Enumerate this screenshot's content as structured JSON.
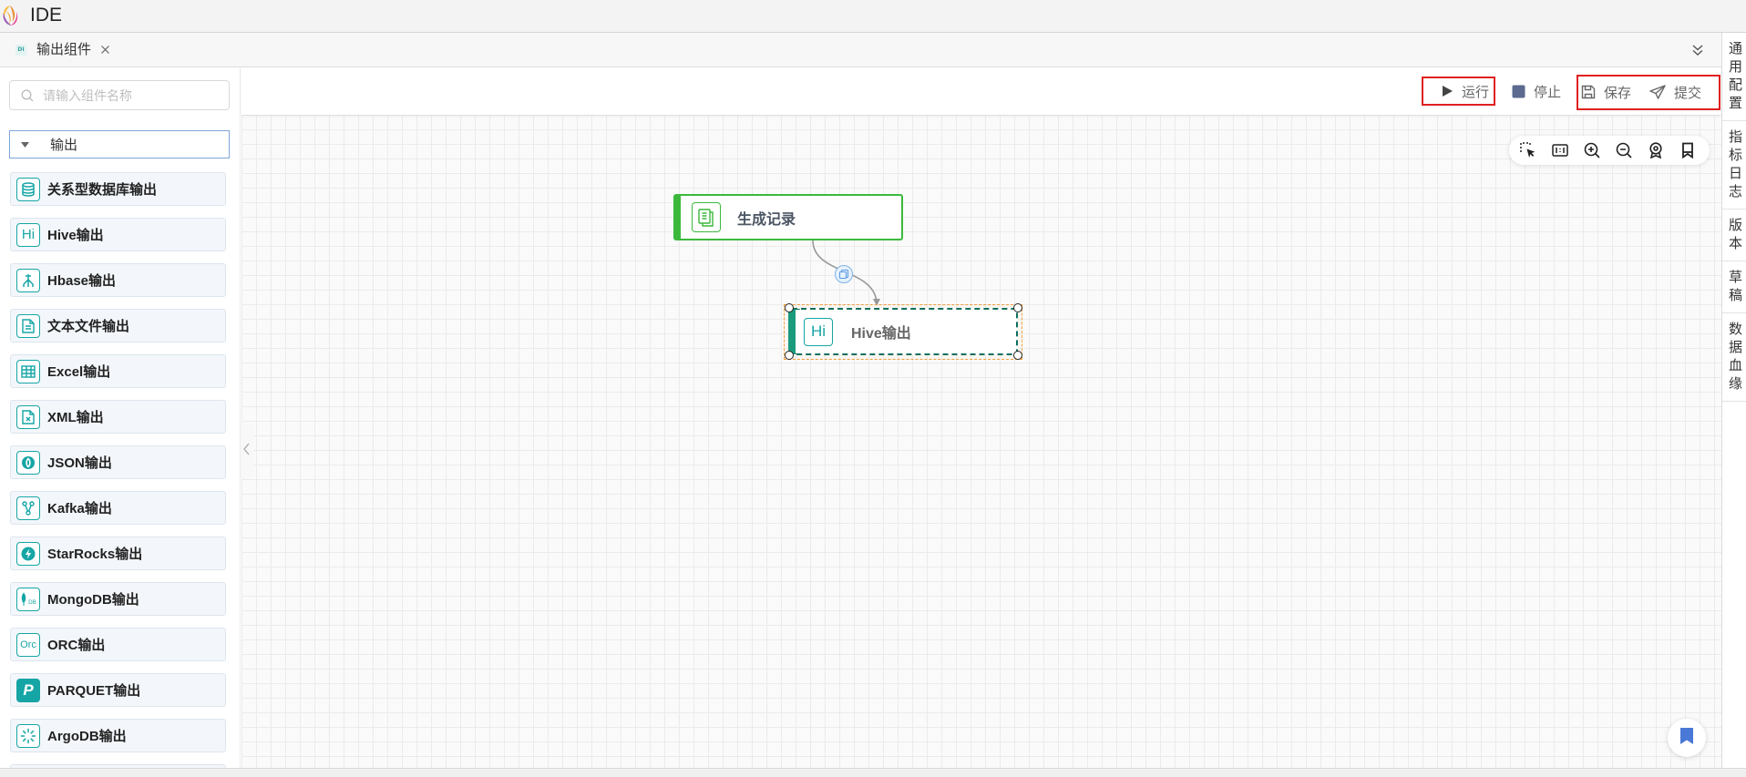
{
  "app": {
    "title": "IDE"
  },
  "tab": {
    "icon_text": "DI",
    "label": "输出组件"
  },
  "toolbar": {
    "run": "运行",
    "stop": "停止",
    "save": "保存",
    "submit": "提交"
  },
  "search": {
    "placeholder": "请输入组件名称",
    "value": ""
  },
  "category": {
    "label": "输出"
  },
  "components": [
    {
      "label": "关系型数据库输出",
      "icon": "database-icon"
    },
    {
      "label": "Hive输出",
      "icon": "hive-icon",
      "icon_text": "Hi"
    },
    {
      "label": "Hbase输出",
      "icon": "hbase-icon"
    },
    {
      "label": "文本文件输出",
      "icon": "text-file-icon"
    },
    {
      "label": "Excel输出",
      "icon": "excel-table-icon"
    },
    {
      "label": "XML输出",
      "icon": "xml-file-icon"
    },
    {
      "label": "JSON输出",
      "icon": "json-icon"
    },
    {
      "label": "Kafka输出",
      "icon": "kafka-icon"
    },
    {
      "label": "StarRocks输出",
      "icon": "starrocks-icon"
    },
    {
      "label": "MongoDB输出",
      "icon": "mongodb-icon",
      "icon_text": "DB"
    },
    {
      "label": "ORC输出",
      "icon": "orc-icon",
      "icon_text": "Orc"
    },
    {
      "label": "PARQUET输出",
      "icon": "parquet-icon",
      "icon_text": "P"
    },
    {
      "label": "ArgoDB输出",
      "icon": "argodb-icon"
    }
  ],
  "right_sidebar": {
    "items": [
      "通用配置",
      "指标日志",
      "版本",
      "草稿",
      "数据血缘"
    ]
  },
  "canvas": {
    "nodes": [
      {
        "label": "生成记录",
        "icon": "document-icon",
        "color": "#3cb93c",
        "selected": false
      },
      {
        "label": "Hive输出",
        "icon": "hive-icon",
        "icon_text": "Hi",
        "color": "#1a9b7c",
        "selected": true
      }
    ],
    "edges": [
      {
        "from": 0,
        "to": 1
      }
    ],
    "tools": [
      "box-select-icon",
      "fit-view-icon",
      "zoom-in-icon",
      "zoom-out-icon",
      "locate-icon",
      "bookmark-icon"
    ]
  },
  "colors": {
    "accent": "#16a5a5",
    "node_source": "#3cb93c",
    "node_selected": "#1a9b7c",
    "highlight": "#e02020",
    "selection_outline": "#f0a040",
    "bookmark": "#4a78d6"
  }
}
